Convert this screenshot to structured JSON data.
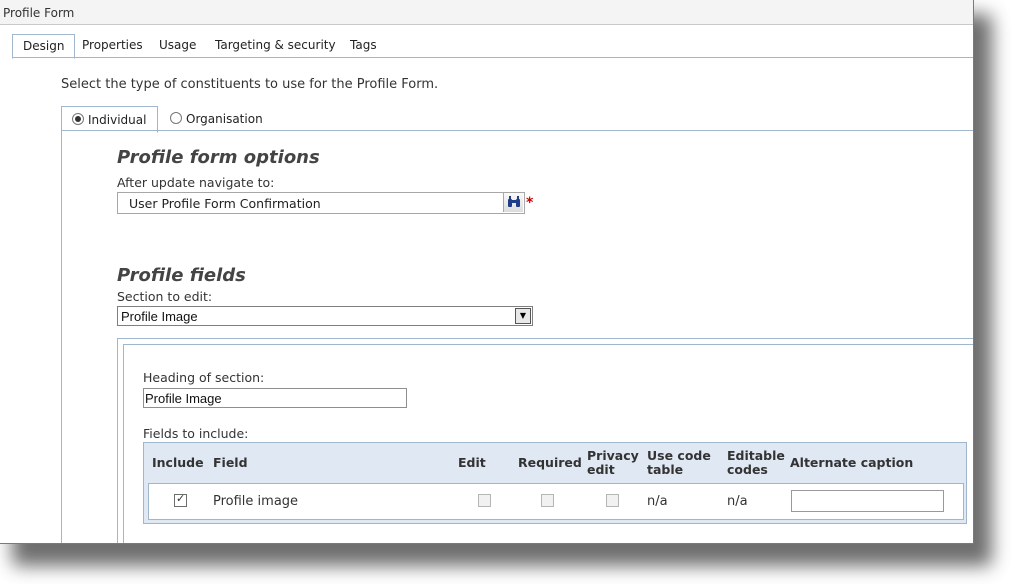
{
  "window": {
    "title": "Profile Form"
  },
  "tabs": [
    {
      "label": "Design",
      "active": true
    },
    {
      "label": "Properties",
      "active": false
    },
    {
      "label": "Usage",
      "active": false
    },
    {
      "label": "Targeting & security",
      "active": false
    },
    {
      "label": "Tags",
      "active": false
    }
  ],
  "intro_text": "Select the type of constituents to use for the Profile Form.",
  "constituent_tabs": [
    {
      "label": "Individual",
      "selected": true
    },
    {
      "label": "Organisation",
      "selected": false
    }
  ],
  "options": {
    "heading": "Profile form options",
    "navigate_label": "After update navigate to:",
    "navigate_value": "User Profile Form Confirmation",
    "required_marker": "*"
  },
  "fields": {
    "heading": "Profile fields",
    "section_label": "Section to edit:",
    "section_value": "Profile Image",
    "heading_of_section_label": "Heading of section:",
    "heading_of_section_value": "Profile Image",
    "fields_to_include_label": "Fields to include:",
    "columns": {
      "include": "Include",
      "field": "Field",
      "edit": "Edit",
      "required": "Required",
      "privacy_edit_1": "Privacy",
      "privacy_edit_2": "edit",
      "use_code_table_1": "Use code",
      "use_code_table_2": "table",
      "editable_codes_1": "Editable",
      "editable_codes_2": "codes",
      "alternate_caption": "Alternate caption"
    },
    "rows": [
      {
        "include": true,
        "field": "Profile image",
        "edit": false,
        "required": false,
        "privacy_edit": false,
        "use_code_table": "n/a",
        "editable_codes": "n/a",
        "alternate_caption": ""
      }
    ]
  },
  "icons": {
    "lookup": "binoculars-icon",
    "dropdown": "chevron-down-icon"
  },
  "colors": {
    "border_blue": "#9fb6cc",
    "grid_header": "#dfe8f3",
    "required": "#cc0000"
  }
}
